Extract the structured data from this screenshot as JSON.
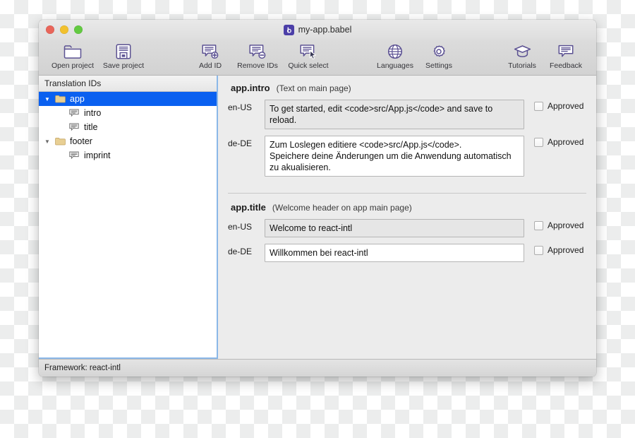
{
  "window": {
    "title": "my-app.babel",
    "doc_icon": "babel-app-icon",
    "traffic_lights": [
      {
        "name": "close-button",
        "color": "#e9655a"
      },
      {
        "name": "minimize-button",
        "color": "#f2c12e"
      },
      {
        "name": "maximize-button",
        "color": "#63ca41"
      }
    ]
  },
  "toolbar": {
    "left_items": [
      {
        "id": "open-project",
        "label": "Open project",
        "icon": "folder-icon"
      },
      {
        "id": "save-project",
        "label": "Save project",
        "icon": "floppy-disk-icon"
      }
    ],
    "mid_items": [
      {
        "id": "add-id",
        "label": "Add ID",
        "icon": "message-plus-icon"
      },
      {
        "id": "remove-ids",
        "label": "Remove IDs",
        "icon": "message-minus-icon"
      },
      {
        "id": "quick-select",
        "label": "Quick select",
        "icon": "message-cursor-icon"
      }
    ],
    "center_items": [
      {
        "id": "languages",
        "label": "Languages",
        "icon": "globe-icon"
      },
      {
        "id": "settings",
        "label": "Settings",
        "icon": "gear-icon"
      }
    ],
    "right_items": [
      {
        "id": "tutorials",
        "label": "Tutorials",
        "icon": "graduation-cap-icon"
      },
      {
        "id": "feedback",
        "label": "Feedback",
        "icon": "speech-bubble-icon"
      }
    ]
  },
  "sidebar": {
    "header": "Translation IDs",
    "tree": [
      {
        "label": "app",
        "type": "folder",
        "level": 0,
        "expanded": true,
        "selected": true,
        "twisty": "▼"
      },
      {
        "label": "intro",
        "type": "message",
        "level": 1,
        "expanded": false,
        "selected": false,
        "twisty": ""
      },
      {
        "label": "title",
        "type": "message",
        "level": 1,
        "expanded": false,
        "selected": false,
        "twisty": ""
      },
      {
        "label": "footer",
        "type": "folder",
        "level": 0,
        "expanded": true,
        "selected": false,
        "twisty": "▼"
      },
      {
        "label": "imprint",
        "type": "message",
        "level": 1,
        "expanded": false,
        "selected": false,
        "twisty": ""
      }
    ]
  },
  "detail": {
    "groups": [
      {
        "id": "app.intro",
        "description": "(Text on main page)",
        "rows": [
          {
            "locale": "en-US",
            "value": "To get started, edit <code>src/App.js</code> and save to reload.",
            "readonly": true,
            "approved_label": "Approved",
            "approved": false
          },
          {
            "locale": "de-DE",
            "value": "Zum Loslegen editiere <code>src/App.js</code>.\nSpeichere deine Änderungen um die Anwendung automatisch zu akualisieren.",
            "readonly": false,
            "approved_label": "Approved",
            "approved": false
          }
        ]
      },
      {
        "id": "app.title",
        "description": "(Welcome header on app main page)",
        "rows": [
          {
            "locale": "en-US",
            "value": "Welcome to react-intl",
            "readonly": true,
            "approved_label": "Approved",
            "approved": false
          },
          {
            "locale": "de-DE",
            "value": "Willkommen bei react-intl",
            "readonly": false,
            "approved_label": "Approved",
            "approved": false
          }
        ]
      }
    ]
  },
  "statusbar": {
    "text": "Framework: react-intl"
  },
  "colors": {
    "selection_blue": "#0a60f0",
    "icon_purple": "#5b5192",
    "focus_ring": "#8bb8e8",
    "folder_tan": "#e3c88a"
  }
}
